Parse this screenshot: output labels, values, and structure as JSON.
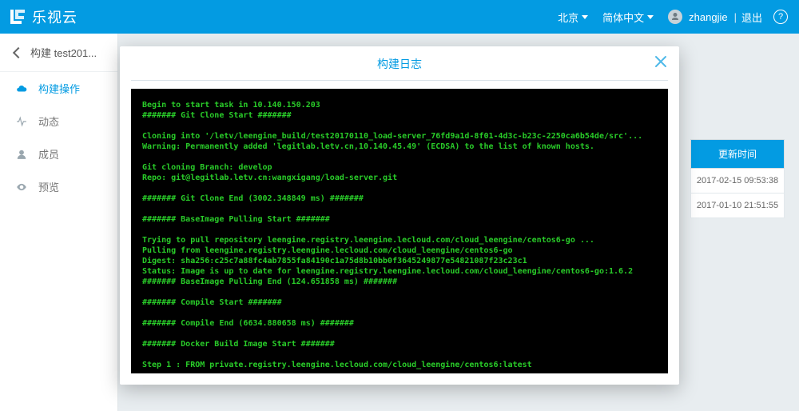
{
  "topbar": {
    "brand": "乐视云",
    "region": "北京",
    "lang": "简体中文",
    "user": "zhangjie",
    "logout": "退出",
    "help": "?"
  },
  "sidebar": {
    "back_label": "构建 test201...",
    "items": [
      {
        "label": "构建操作"
      },
      {
        "label": "动态"
      },
      {
        "label": "成员"
      },
      {
        "label": "预览"
      }
    ]
  },
  "table": {
    "header": "更新时间",
    "rows": [
      "2017-02-15 09:53:38",
      "2017-01-10 21:51:55"
    ]
  },
  "modal": {
    "title": "构建日志",
    "log": "Begin to start task in 10.140.150.203\n####### Git Clone Start #######\n\nCloning into '/letv/leengine_build/test20170110_load-server_76fd9a1d-8f01-4d3c-b23c-2250ca6b54de/src'...\nWarning: Permanently added 'legitlab.letv.cn,10.140.45.49' (ECDSA) to the list of known hosts.\n\nGit cloning Branch: develop\nRepo: git@legitlab.letv.cn:wangxigang/load-server.git\n\n####### Git Clone End (3002.348849 ms) #######\n\n####### BaseImage Pulling Start #######\n\nTrying to pull repository leengine.registry.leengine.lecloud.com/cloud_leengine/centos6-go ...\nPulling from leengine.registry.leengine.lecloud.com/cloud_leengine/centos6-go\nDigest: sha256:c25c7a88fc4ab7855fa84190c1a75d8b10bb0f3645249877e54821087f23c23c1\nStatus: Image is up to date for leengine.registry.leengine.lecloud.com/cloud_leengine/centos6-go:1.6.2\n####### BaseImage Pulling End (124.651858 ms) #######\n\n####### Compile Start #######\n\n####### Compile End (6634.880658 ms) #######\n\n####### Docker Build Image Start #######\n\nStep 1 : FROM private.registry.leengine.lecloud.com/cloud_leengine/centos6:latest"
  }
}
